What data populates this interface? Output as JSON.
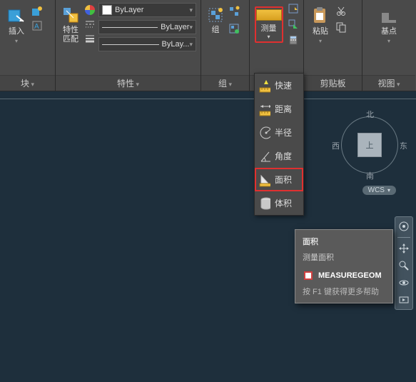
{
  "ribbon": {
    "panels": {
      "blocks": {
        "title": "块",
        "insert": "插入"
      },
      "properties": {
        "title": "特性",
        "match": "特性\n匹配",
        "layer": "ByLayer",
        "linetype": "ByLayer",
        "lineweight": "ByLay..."
      },
      "group": {
        "title": "组",
        "label": "组"
      },
      "utilities": {
        "title": "",
        "measure": "测量"
      },
      "clipboard": {
        "title": "剪贴板",
        "paste": "粘贴"
      },
      "view": {
        "title": "视图",
        "basepoint": "基点"
      }
    }
  },
  "measure_menu": {
    "quick": "快速",
    "distance": "距离",
    "radius": "半径",
    "angle": "角度",
    "area": "面积",
    "volume": "体积"
  },
  "tooltip": {
    "title": "面积",
    "desc": "测量面积",
    "cmd": "MEASUREGEOM",
    "help": "按 F1 键获得更多帮助"
  },
  "viewcube": {
    "top": "上",
    "north": "北",
    "south": "南",
    "west": "西",
    "east": "东",
    "wcs": "WCS"
  }
}
